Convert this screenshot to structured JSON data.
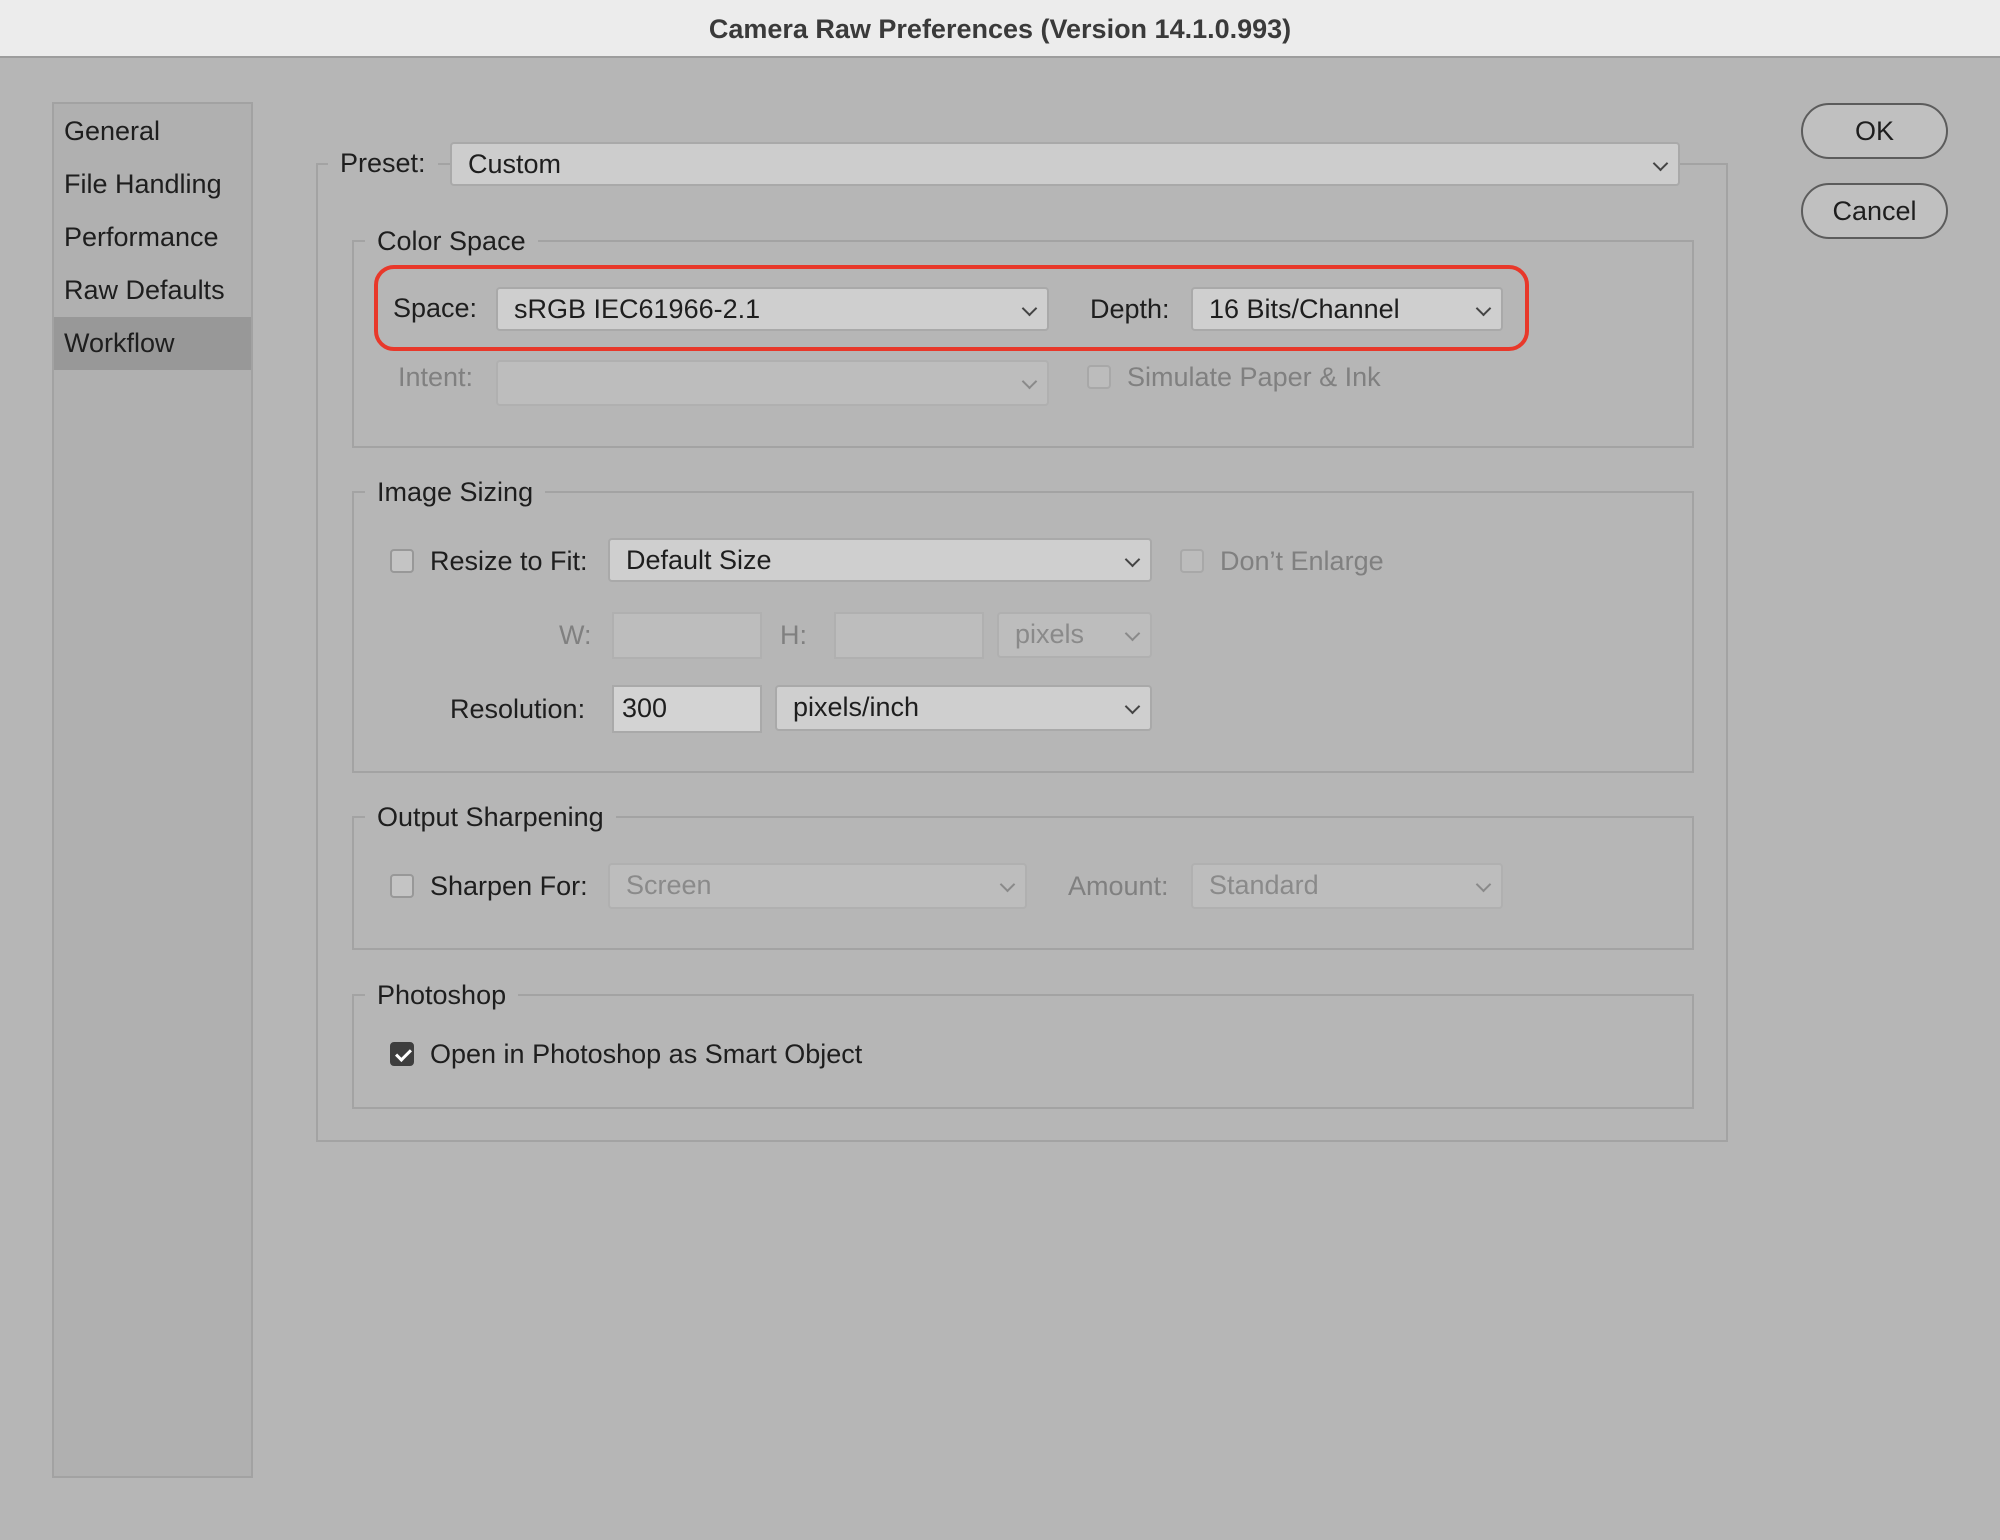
{
  "window": {
    "title": "Camera Raw Preferences  (Version 14.1.0.993)"
  },
  "sidebar": {
    "items": [
      {
        "label": "General",
        "selected": false
      },
      {
        "label": "File Handling",
        "selected": false
      },
      {
        "label": "Performance",
        "selected": false
      },
      {
        "label": "Raw Defaults",
        "selected": false
      },
      {
        "label": "Workflow",
        "selected": true
      }
    ]
  },
  "preset": {
    "label": "Preset:",
    "value": "Custom"
  },
  "color_space": {
    "title": "Color Space",
    "space_label": "Space:",
    "space_value": "sRGB IEC61966-2.1",
    "depth_label": "Depth:",
    "depth_value": "16 Bits/Channel",
    "intent_label": "Intent:",
    "intent_value": "",
    "simulate_label": "Simulate Paper & Ink",
    "simulate_checked": false,
    "highlight_color": "#e8382a"
  },
  "image_sizing": {
    "title": "Image Sizing",
    "resize_label": "Resize to Fit:",
    "resize_checked": false,
    "resize_value": "Default Size",
    "dont_enlarge_label": "Don’t Enlarge",
    "dont_enlarge_checked": false,
    "w_label": "W:",
    "w_value": "",
    "h_label": "H:",
    "h_value": "",
    "units_value": "pixels",
    "resolution_label": "Resolution:",
    "resolution_value": "300",
    "resolution_units": "pixels/inch"
  },
  "output_sharpening": {
    "title": "Output Sharpening",
    "sharpen_label": "Sharpen For:",
    "sharpen_checked": false,
    "sharpen_value": "Screen",
    "amount_label": "Amount:",
    "amount_value": "Standard"
  },
  "photoshop": {
    "title": "Photoshop",
    "smart_object_label": "Open in Photoshop as Smart Object",
    "smart_object_checked": true
  },
  "buttons": {
    "ok": "OK",
    "cancel": "Cancel"
  }
}
